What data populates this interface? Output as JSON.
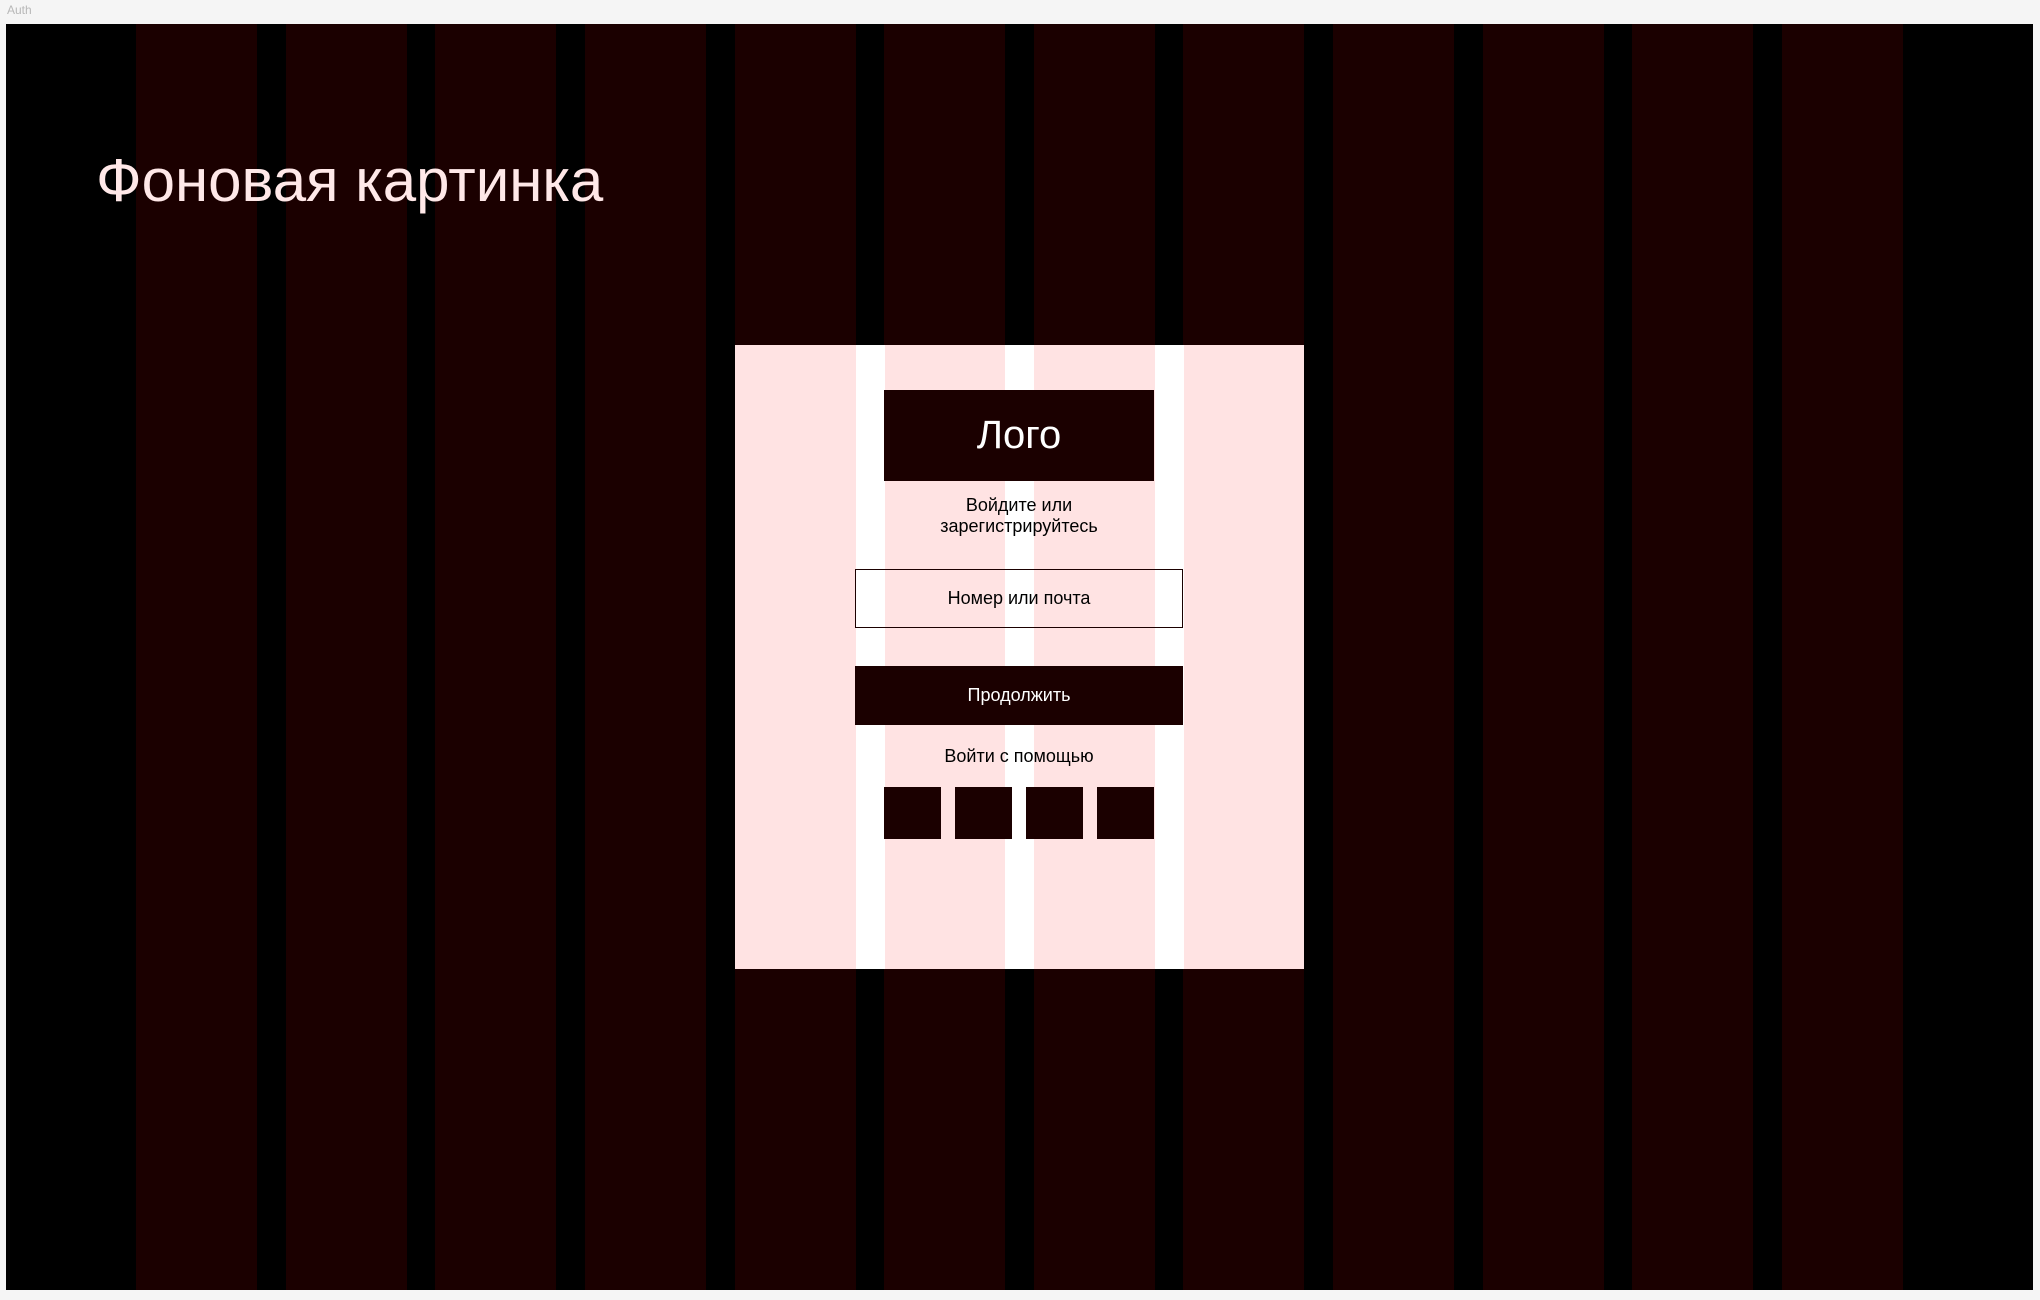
{
  "frame": {
    "label": "Auth"
  },
  "background": {
    "title": "Фоновая картинка"
  },
  "auth_card": {
    "logo": "Лого",
    "prompt_line1": "Войдите или",
    "prompt_line2": "зарегистрируйтесь",
    "input_placeholder": "Номер или почта",
    "continue_label": "Продолжить",
    "social_label": "Войти с помощью",
    "social_buttons": [
      "social-button-1",
      "social-button-2",
      "social-button-3",
      "social-button-4"
    ]
  },
  "colors": {
    "frame_background": "#000000",
    "grid_column": "#1b0000",
    "card_background": "#ffe3e3",
    "card_gutter": "#ffffff",
    "primary": "#1b0000",
    "title_text": "#ffe8e8"
  }
}
